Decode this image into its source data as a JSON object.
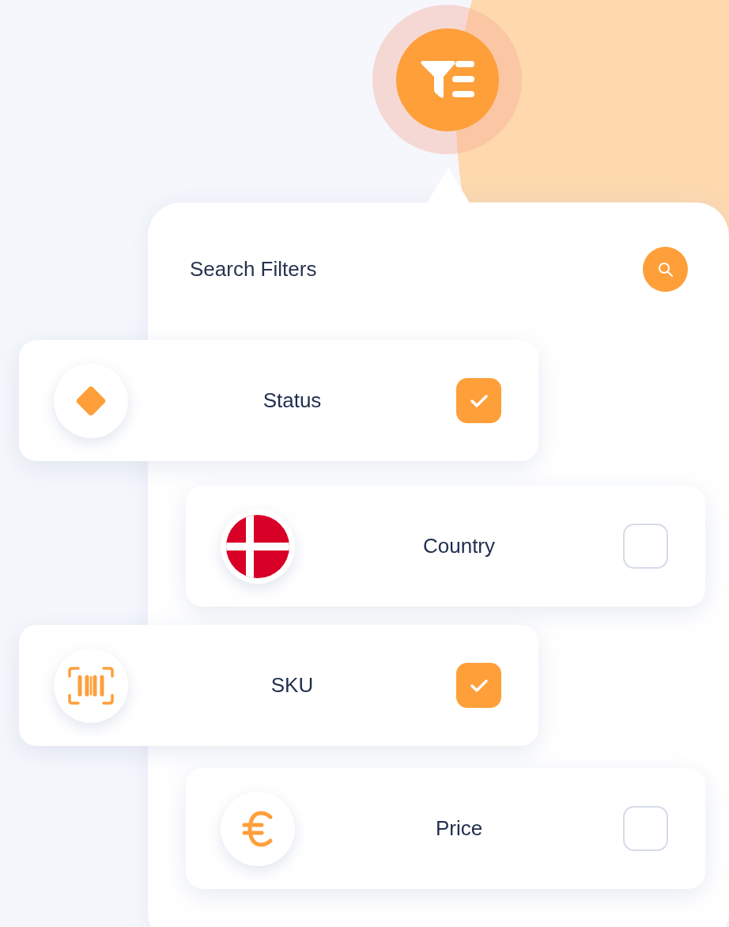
{
  "panel": {
    "title": "Search Filters"
  },
  "filters": [
    {
      "label": "Status",
      "checked": true
    },
    {
      "label": "Country",
      "checked": false
    },
    {
      "label": "SKU",
      "checked": true
    },
    {
      "label": "Price",
      "checked": false
    }
  ]
}
